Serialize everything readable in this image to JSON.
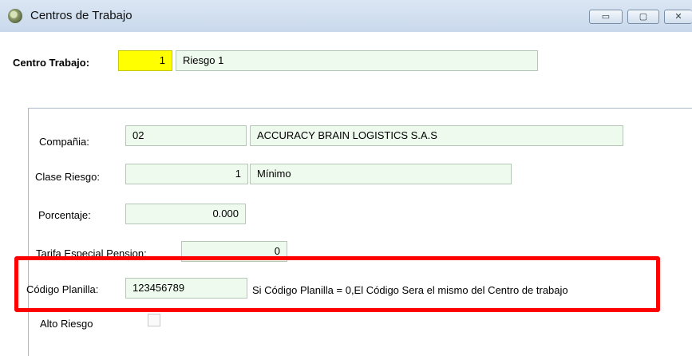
{
  "window": {
    "title": "Centros de Trabajo",
    "controls": {
      "minimize": "▭",
      "maximize": "▢",
      "close": "✕"
    }
  },
  "header": {
    "centro_label": "Centro Trabajo:",
    "centro_code": "1",
    "centro_name": "Riesgo 1"
  },
  "form": {
    "compania_label": "Compañia:",
    "compania_code": "02",
    "compania_name": "ACCURACY BRAIN LOGISTICS S.A.S",
    "clase_label": "Clase Riesgo:",
    "clase_code": "1",
    "clase_name": "Mínimo",
    "porcentaje_label": "Porcentaje:",
    "porcentaje_value": "0.000",
    "tarifa_label": "Tarifa Especial Pension:",
    "tarifa_value": "0",
    "codigo_label": "Código Planilla:",
    "codigo_value": "123456789",
    "codigo_note": "Si Código Planilla = 0,El Código Sera el mismo del Centro de trabajo",
    "alto_label": "Alto Riesgo",
    "alto_checked": false
  },
  "colors": {
    "highlight": "#ff0000",
    "field_bg": "#eefaee",
    "key_field_bg": "#ffff00"
  }
}
